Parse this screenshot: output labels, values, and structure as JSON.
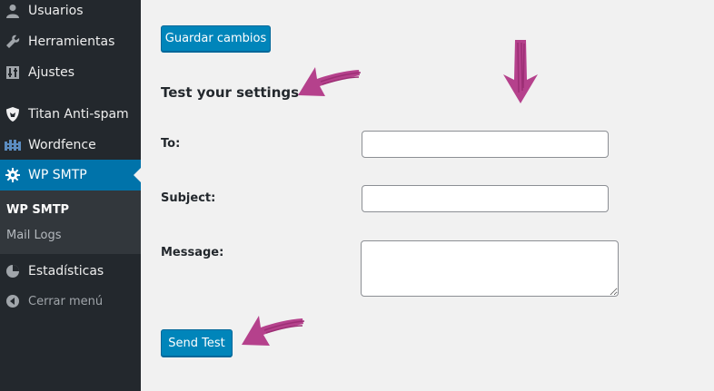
{
  "sidebar": {
    "items": [
      {
        "label": "Usuarios",
        "icon": "users-icon"
      },
      {
        "label": "Herramientas",
        "icon": "wrench-icon"
      },
      {
        "label": "Ajustes",
        "icon": "settings-sliders-icon"
      },
      {
        "label": "Titan Anti-spam",
        "icon": "shield-icon"
      },
      {
        "label": "Wordfence",
        "icon": "wordfence-icon"
      },
      {
        "label": "WP SMTP",
        "icon": "gear-icon",
        "active": true
      }
    ],
    "submenu": [
      {
        "label": "WP SMTP",
        "current": true
      },
      {
        "label": "Mail Logs"
      }
    ],
    "stats": {
      "label": "Estadísticas",
      "icon": "pie-chart-icon"
    },
    "collapse": {
      "label": "Cerrar menú",
      "icon": "collapse-icon"
    }
  },
  "main": {
    "save_button": "Guardar cambios",
    "section_title": "Test your settings",
    "fields": {
      "to_label": "To:",
      "to_value": "",
      "subject_label": "Subject:",
      "subject_value": "",
      "message_label": "Message:",
      "message_value": ""
    },
    "send_button": "Send Test"
  },
  "colors": {
    "sidebar_bg": "#23282d",
    "submenu_bg": "#32373c",
    "accent": "#0073aa",
    "button": "#0085ba",
    "annotation": "#b5418c",
    "page_bg": "#f1f1f1"
  }
}
